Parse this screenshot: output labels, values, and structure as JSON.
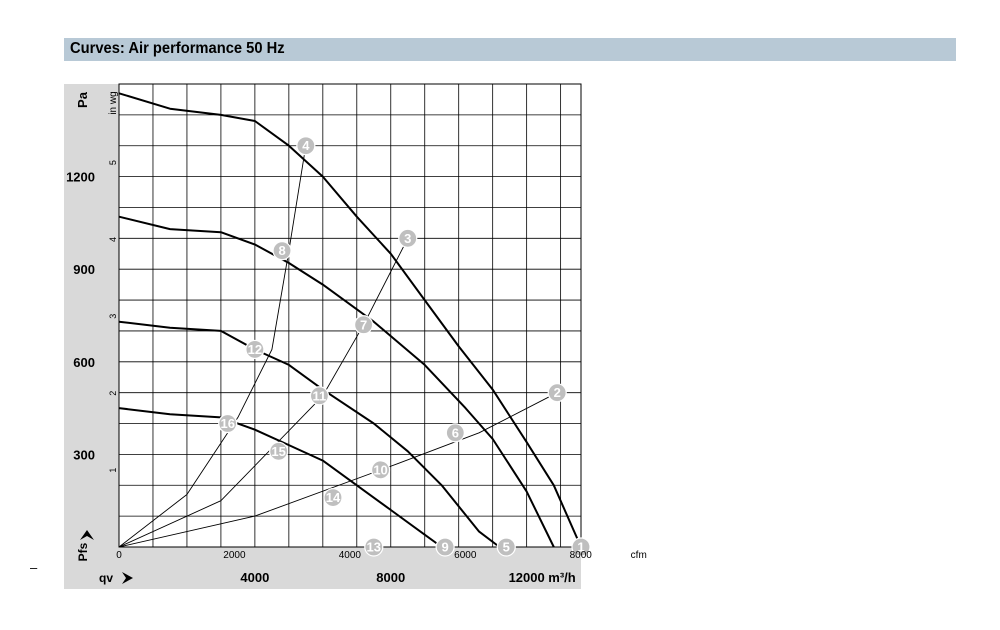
{
  "header": {
    "title": "Curves: Air performance 50 Hz"
  },
  "page": {
    "dash": "–"
  },
  "chart_data": {
    "type": "line",
    "title": "Curves: Air performance 50 Hz",
    "y_axis_left": {
      "unit": "Pa",
      "ticks": [
        "300",
        "600",
        "900",
        "1200"
      ],
      "ylim": [
        0,
        1500
      ],
      "bottom_label": "Pfs"
    },
    "y_axis_inner": {
      "unit": "in wg",
      "ticks": [
        "1",
        "2",
        "3",
        "4",
        "5"
      ]
    },
    "x_axis_bottom": {
      "label": "qv",
      "unit": "m³/h",
      "ticks": [
        "4000",
        "8000",
        "12000"
      ],
      "xlim": [
        0,
        13600
      ]
    },
    "x_axis_inner": {
      "unit": "cfm",
      "ticks": [
        "0",
        "2000",
        "4000",
        "6000",
        "8000"
      ]
    },
    "series": [
      {
        "name": "",
        "points": [
          [
            0,
            1470
          ],
          [
            1500,
            1420
          ],
          [
            3000,
            1400
          ],
          [
            4000,
            1380
          ],
          [
            5000,
            1300
          ],
          [
            6000,
            1200
          ],
          [
            7000,
            1070
          ],
          [
            8000,
            950
          ],
          [
            9000,
            800
          ],
          [
            10000,
            650
          ],
          [
            11000,
            510
          ],
          [
            12000,
            340
          ],
          [
            12800,
            200
          ],
          [
            13600,
            0
          ]
        ]
      },
      {
        "name": "",
        "points": [
          [
            0,
            1070
          ],
          [
            1500,
            1030
          ],
          [
            3000,
            1020
          ],
          [
            4000,
            980
          ],
          [
            5000,
            920
          ],
          [
            6000,
            850
          ],
          [
            7500,
            730
          ],
          [
            9000,
            590
          ],
          [
            10200,
            450
          ],
          [
            11000,
            350
          ],
          [
            12000,
            180
          ],
          [
            12800,
            0
          ]
        ]
      },
      {
        "name": "",
        "points": [
          [
            0,
            730
          ],
          [
            1500,
            710
          ],
          [
            3000,
            700
          ],
          [
            4000,
            640
          ],
          [
            5000,
            590
          ],
          [
            6000,
            510
          ],
          [
            7500,
            400
          ],
          [
            8500,
            310
          ],
          [
            9500,
            200
          ],
          [
            10600,
            50
          ],
          [
            11200,
            0
          ]
        ]
      },
      {
        "name": "",
        "points": [
          [
            0,
            450
          ],
          [
            1500,
            430
          ],
          [
            3000,
            420
          ],
          [
            4000,
            380
          ],
          [
            5000,
            330
          ],
          [
            6000,
            280
          ],
          [
            7000,
            200
          ],
          [
            8000,
            120
          ],
          [
            9000,
            40
          ],
          [
            9500,
            0
          ]
        ]
      }
    ],
    "system_curves": [
      {
        "points": [
          [
            0,
            0
          ],
          [
            2000,
            170
          ],
          [
            3500,
            420
          ],
          [
            4500,
            640
          ],
          [
            5000,
            960
          ],
          [
            5500,
            1300
          ]
        ]
      },
      {
        "points": [
          [
            0,
            0
          ],
          [
            3000,
            150
          ],
          [
            6000,
            490
          ],
          [
            7200,
            720
          ],
          [
            8500,
            1000
          ]
        ]
      },
      {
        "points": [
          [
            0,
            0
          ],
          [
            4000,
            100
          ],
          [
            8200,
            270
          ],
          [
            10600,
            370
          ],
          [
            12900,
            500
          ]
        ]
      }
    ],
    "operating_points": [
      {
        "label": "1",
        "x": 13600,
        "y": 0
      },
      {
        "label": "2",
        "x": 12900,
        "y": 500
      },
      {
        "label": "3",
        "x": 8500,
        "y": 1000
      },
      {
        "label": "4",
        "x": 5500,
        "y": 1300
      },
      {
        "label": "5",
        "x": 11400,
        "y": 0
      },
      {
        "label": "6",
        "x": 9900,
        "y": 370
      },
      {
        "label": "7",
        "x": 7200,
        "y": 720
      },
      {
        "label": "8",
        "x": 4800,
        "y": 960
      },
      {
        "label": "9",
        "x": 9600,
        "y": 0
      },
      {
        "label": "10",
        "x": 7700,
        "y": 250
      },
      {
        "label": "11",
        "x": 5900,
        "y": 490
      },
      {
        "label": "12",
        "x": 4000,
        "y": 640
      },
      {
        "label": "13",
        "x": 7500,
        "y": 0
      },
      {
        "label": "14",
        "x": 6300,
        "y": 160
      },
      {
        "label": "15",
        "x": 4700,
        "y": 310
      },
      {
        "label": "16",
        "x": 3200,
        "y": 400
      }
    ],
    "grid": true
  }
}
